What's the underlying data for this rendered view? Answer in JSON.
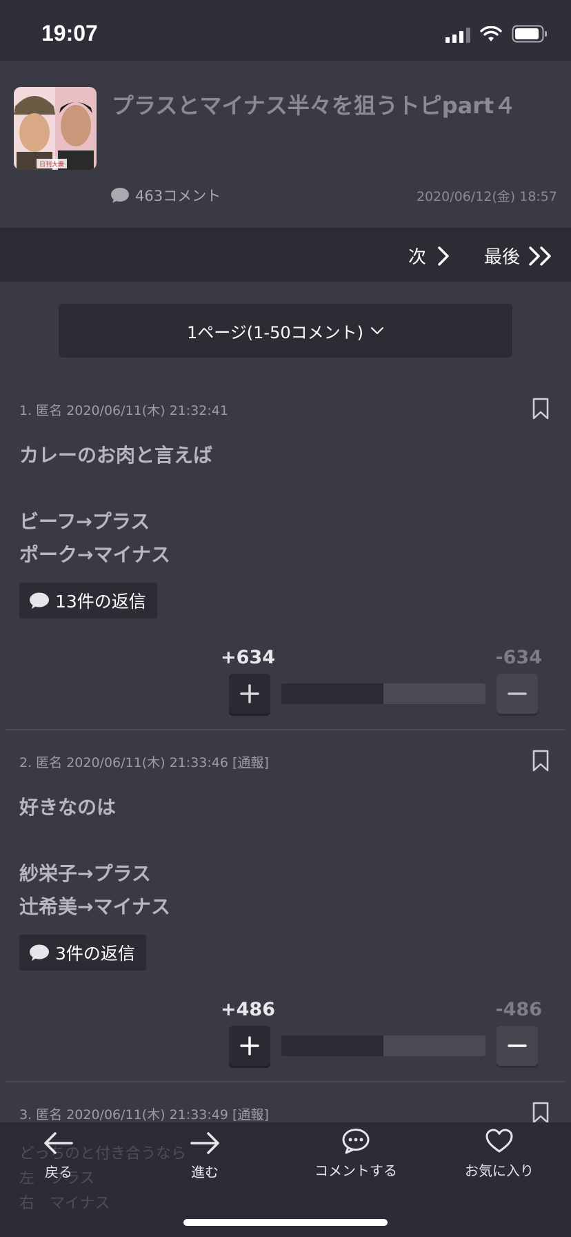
{
  "status": {
    "time": "19:07"
  },
  "topic": {
    "title": "プラスとマイナス半々を狙うトピpart４",
    "thumb_caption": "日刊大衆",
    "comment_count": "463コメント",
    "date": "2020/06/12(金) 18:57"
  },
  "pager": {
    "next": "次",
    "last": "最後",
    "page_select": "1ページ(1-50コメント)"
  },
  "comments": [
    {
      "meta": "1. 匿名 2020/06/11(木) 21:32:41",
      "report": "",
      "lines": [
        "カレーのお肉と言えば",
        "",
        "ビーフ→プラス",
        "ポーク→マイナス"
      ],
      "replies": "13件の返信",
      "plus": "+634",
      "minus": "-634",
      "plus_ratio": 0.5
    },
    {
      "meta": "2. 匿名 2020/06/11(木) 21:33:46",
      "report": "[通報]",
      "lines": [
        "好きなのは",
        "",
        "紗栄子→プラス",
        "辻希美→マイナス"
      ],
      "replies": "3件の返信",
      "plus": "+486",
      "minus": "-486",
      "plus_ratio": 0.5
    },
    {
      "meta": "3. 匿名 2020/06/11(木) 21:33:49",
      "report": "[通報]",
      "lines": [
        "どっちのと付き合うなら",
        "左　プラス",
        "右　マイナス"
      ]
    }
  ],
  "tabbar": {
    "back": "戻る",
    "forward": "進む",
    "comment": "コメントする",
    "favorite": "お気に入り"
  },
  "colors": {
    "background": "#3a3a45",
    "bar": "#2c2c35",
    "accent": "#ffffff"
  }
}
